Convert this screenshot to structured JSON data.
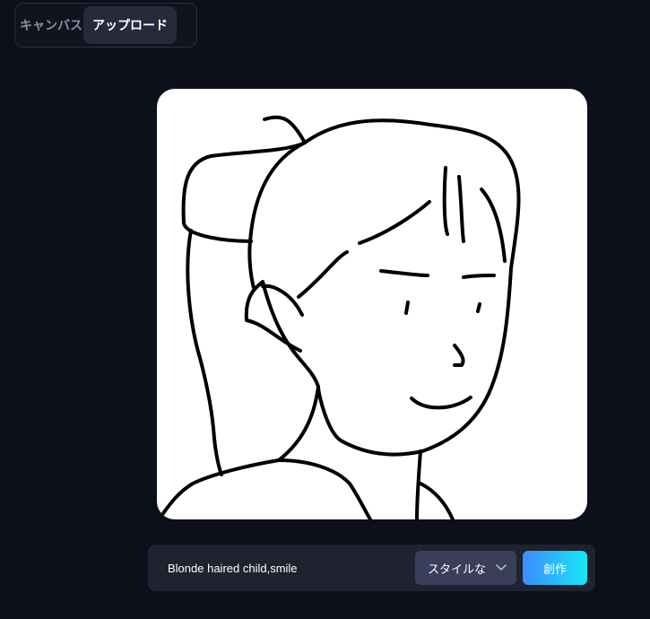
{
  "tabs": [
    {
      "label": "キャンバス",
      "active": false
    },
    {
      "label": "アップロード",
      "active": true
    }
  ],
  "canvas": {
    "image_description_icon": "uploaded-line-drawing"
  },
  "prompt_bar": {
    "prompt_value": "Blonde haired child,smile",
    "style_select_value": "スタイルな",
    "create_label": "創作"
  },
  "colors": {
    "background": "#0d0f1a",
    "active_tab": "#262b3b",
    "select_bg": "#3a3e5a",
    "gradient_start": "#3b8cff",
    "gradient_end": "#19e6f5"
  }
}
